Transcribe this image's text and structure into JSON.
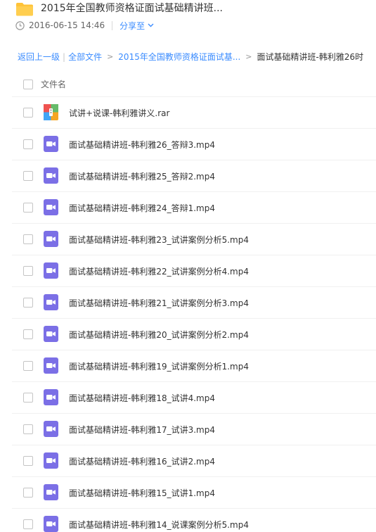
{
  "header": {
    "title": "2015年全国教师资格证面试基础精讲班...",
    "timestamp": "2016-06-15 14:46",
    "share_label": "分享至"
  },
  "breadcrumb": {
    "back": "返回上一级",
    "all_files": "全部文件",
    "parent": "2015年全国教师资格证面试基...",
    "current": "面试基础精讲班-韩利雅26时"
  },
  "list": {
    "column_header": "文件名",
    "files": [
      {
        "name": "试讲+说课-韩利雅讲义.rar",
        "type": "rar"
      },
      {
        "name": "面试基础精讲班-韩利雅26_答辩3.mp4",
        "type": "video"
      },
      {
        "name": "面试基础精讲班-韩利雅25_答辩2.mp4",
        "type": "video"
      },
      {
        "name": "面试基础精讲班-韩利雅24_答辩1.mp4",
        "type": "video"
      },
      {
        "name": "面试基础精讲班-韩利雅23_试讲案例分析5.mp4",
        "type": "video"
      },
      {
        "name": "面试基础精讲班-韩利雅22_试讲案例分析4.mp4",
        "type": "video"
      },
      {
        "name": "面试基础精讲班-韩利雅21_试讲案例分析3.mp4",
        "type": "video"
      },
      {
        "name": "面试基础精讲班-韩利雅20_试讲案例分析2.mp4",
        "type": "video"
      },
      {
        "name": "面试基础精讲班-韩利雅19_试讲案例分析1.mp4",
        "type": "video"
      },
      {
        "name": "面试基础精讲班-韩利雅18_试讲4.mp4",
        "type": "video"
      },
      {
        "name": "面试基础精讲班-韩利雅17_试讲3.mp4",
        "type": "video"
      },
      {
        "name": "面试基础精讲班-韩利雅16_试讲2.mp4",
        "type": "video"
      },
      {
        "name": "面试基础精讲班-韩利雅15_试讲1.mp4",
        "type": "video"
      },
      {
        "name": "面试基础精讲班-韩利雅14_说课案例分析5.mp4",
        "type": "video"
      }
    ]
  },
  "colors": {
    "link": "#3b8cff",
    "folder": "#ffc338",
    "video_icon": "#7b6fe6",
    "divider": "#f0f0f0"
  },
  "icons": {
    "folder": "folder-icon",
    "clock": "clock-icon",
    "video": "video-file-icon",
    "archive": "archive-file-icon"
  }
}
